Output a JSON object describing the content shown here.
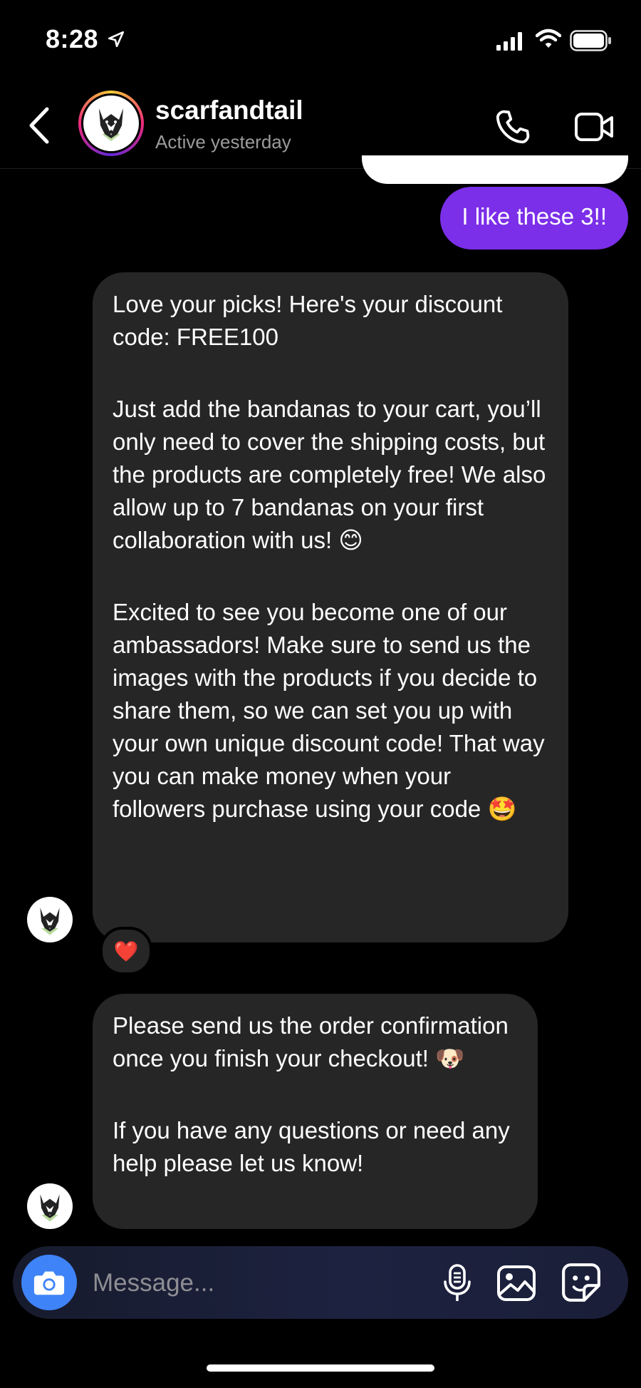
{
  "status_bar": {
    "time": "8:28",
    "location_icon": "location-arrow-icon",
    "signal_icon": "cellular-signal-icon",
    "wifi_icon": "wifi-icon",
    "battery_icon": "battery-icon"
  },
  "header": {
    "username": "scarfandtail",
    "active_status": "Active yesterday",
    "back_icon": "chevron-left-icon",
    "call_icon": "phone-icon",
    "video_icon": "video-camera-icon"
  },
  "messages": {
    "sent_1": "I like these 3!!",
    "received_1": {
      "p1": "Love your picks! Here's your discount code: FREE100",
      "p2": "Just add the bandanas to your cart, you’ll only need to cover the shipping costs, but the products are completely free! We also allow up to 7 bandanas on your first collaboration with us! 😊",
      "p3": "Excited to see you become one of our ambassadors! Make sure to send us the images with the products if you decide to share them, so we can set you up with your own unique discount code! That way you can make money when your followers purchase using your code 🤩"
    },
    "reaction": "❤️",
    "received_2": {
      "p1": "Please send us the order confirmation once you finish your checkout! 🐶",
      "p2": "If you have any questions or need any help please let us know!"
    }
  },
  "composer": {
    "placeholder": "Message...",
    "camera_icon": "camera-icon",
    "mic_icon": "microphone-icon",
    "gallery_icon": "image-gallery-icon",
    "sticker_icon": "sticker-icon"
  },
  "colors": {
    "sent_bubble": "#7b2fe8",
    "received_bubble": "#262626",
    "camera_button": "#3f83f8",
    "background": "#000000"
  }
}
